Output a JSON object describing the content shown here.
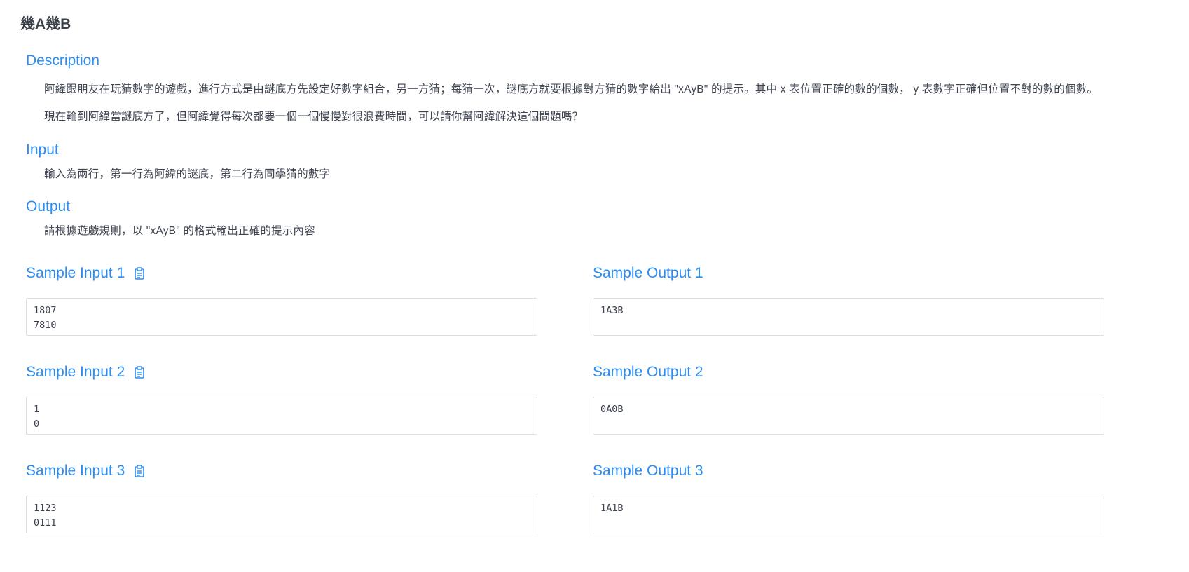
{
  "problem": {
    "title": "幾A幾B"
  },
  "description": {
    "heading": "Description",
    "paragraphs": [
      "阿緯跟朋友在玩猜數字的遊戲，進行方式是由謎底方先設定好數字組合，另一方猜；每猜一次，謎底方就要根據對方猜的數字給出 \"xAyB\" 的提示。其中 x 表位置正確的數的個數， y 表數字正確但位置不對的數的個數。",
      "現在輪到阿緯當謎底方了，但阿緯覺得每次都要一個一個慢慢對很浪費時間，可以請你幫阿緯解決這個問題嗎？"
    ]
  },
  "input": {
    "heading": "Input",
    "text": "輸入為兩行，第一行為阿緯的謎底，第二行為同學猜的數字"
  },
  "output": {
    "heading": "Output",
    "text": "請根據遊戲規則，以 \"xAyB\" 的格式輸出正確的提示內容"
  },
  "samples": [
    {
      "input_label": "Sample Input 1",
      "output_label": "Sample Output 1",
      "input": "1807\n7810",
      "output": "1A3B"
    },
    {
      "input_label": "Sample Input 2",
      "output_label": "Sample Output 2",
      "input": "1\n0",
      "output": "0A0B"
    },
    {
      "input_label": "Sample Input 3",
      "output_label": "Sample Output 3",
      "input": "1123\n0111",
      "output": "1A1B"
    }
  ],
  "icons": {
    "copy": "clipboard-icon"
  },
  "colors": {
    "accent": "#2d8cf0",
    "text": "#3d4250",
    "border": "#dcdee2"
  }
}
